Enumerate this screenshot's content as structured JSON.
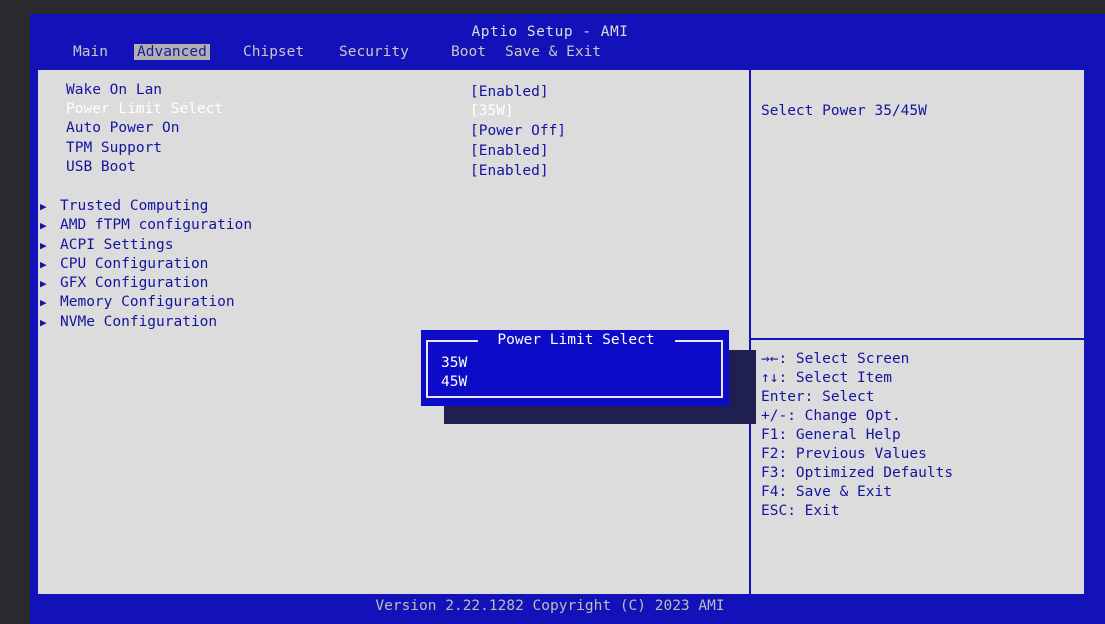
{
  "header": {
    "title": "Aptio Setup - AMI",
    "tabs": [
      "Main",
      "Advanced",
      "Chipset",
      "Security",
      "Boot",
      "Save & Exit"
    ],
    "active_tab": "Advanced"
  },
  "settings": [
    {
      "label": "Wake On Lan",
      "value": "[Enabled]"
    },
    {
      "label": "Power Limit Select",
      "value": "[35W]",
      "selected": true
    },
    {
      "label": "Auto Power On",
      "value": "[Power Off]"
    },
    {
      "label": "TPM Support",
      "value": "[Enabled]"
    },
    {
      "label": "USB Boot",
      "value": "[Enabled]"
    }
  ],
  "submenus": [
    "Trusted Computing",
    "AMD fTPM configuration",
    "ACPI Settings",
    "CPU Configuration",
    "GFX Configuration",
    "Memory Configuration",
    "NVMe Configuration"
  ],
  "help": {
    "text": "Select Power 35/45W",
    "keys": [
      "→←: Select Screen",
      "↑↓: Select Item",
      "Enter: Select",
      "+/-: Change Opt.",
      "F1: General Help",
      "F2: Previous Values",
      "F3: Optimized Defaults",
      "F4: Save & Exit",
      "ESC: Exit"
    ]
  },
  "popup": {
    "title": "Power Limit Select",
    "options": [
      "35W",
      "45W"
    ],
    "highlighted": "45W"
  },
  "footer": "Version 2.22.1282 Copyright (C) 2023 AMI",
  "colors": {
    "background": "#1212b8",
    "panel": "#dcdcdc",
    "text": "#1414a0",
    "highlight": "#ffffff"
  }
}
